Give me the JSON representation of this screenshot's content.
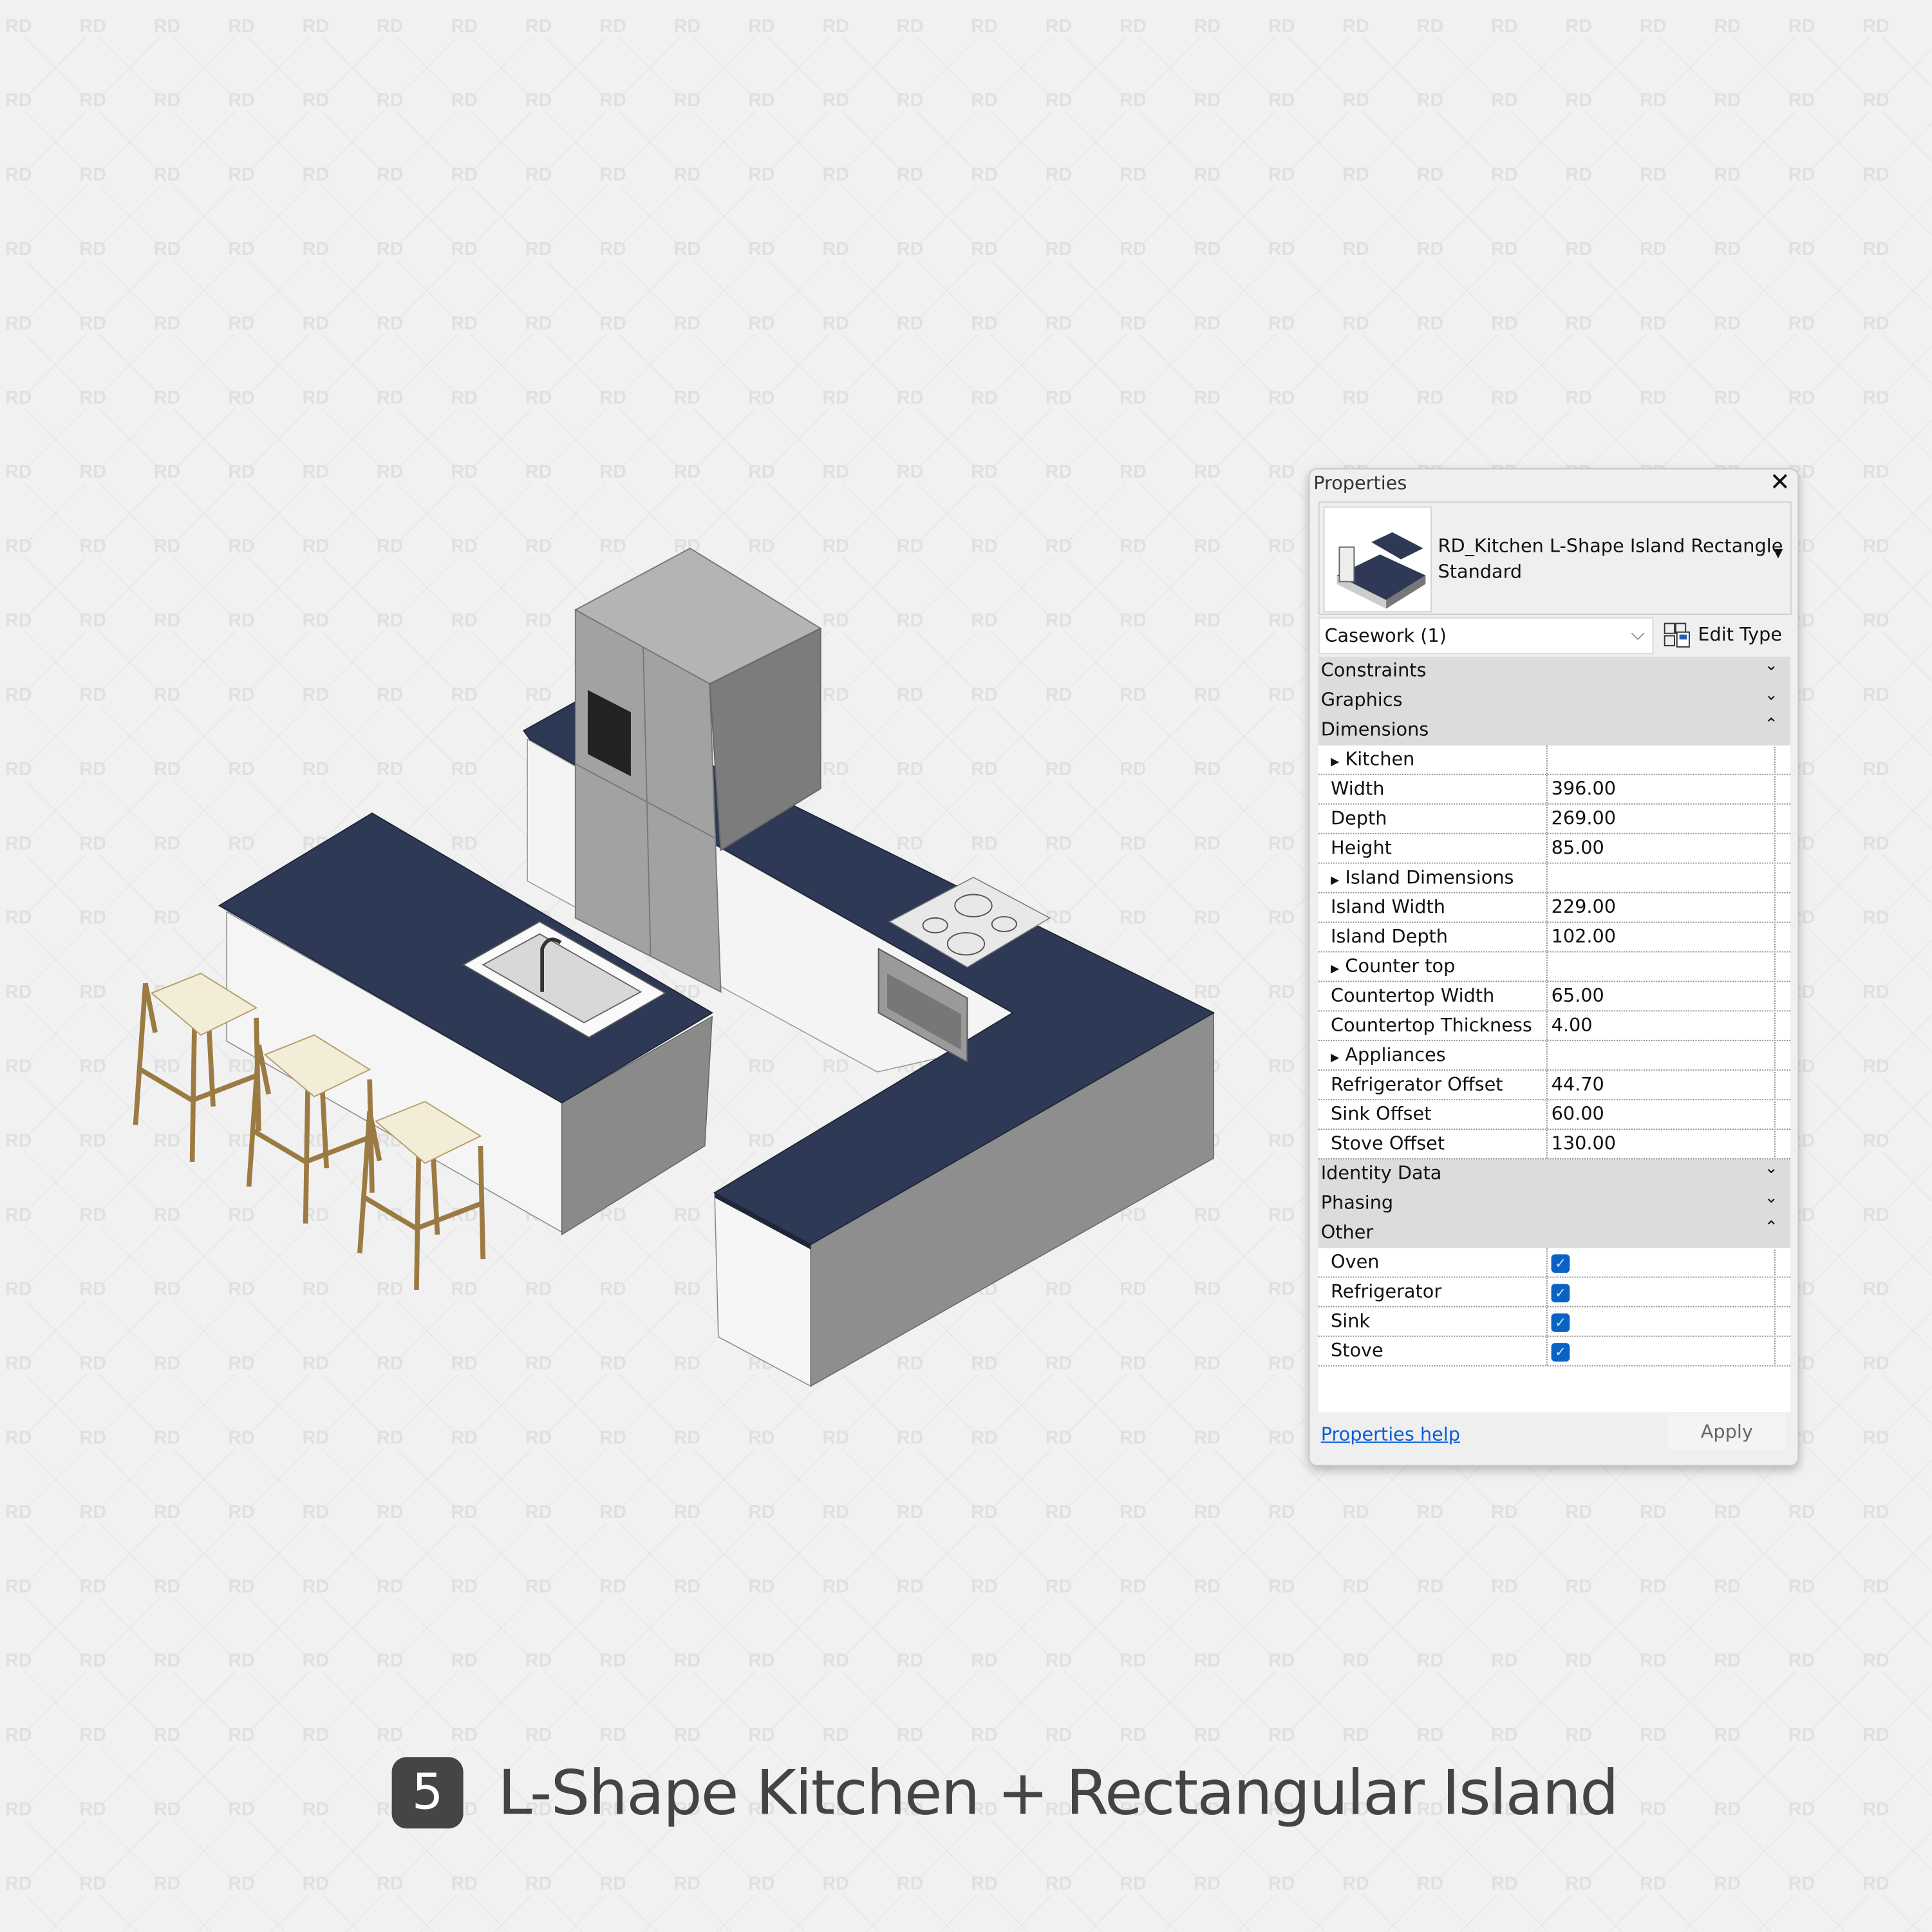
{
  "watermark": "RD",
  "colors": {
    "countertop": "#2e3a55",
    "checkbox": "#0a63c4",
    "link": "#0b5dd7",
    "badge": "#454545"
  },
  "properties": {
    "title": "Properties",
    "close_icon": "close-icon",
    "type_name_line1": "RD_Kitchen L-Shape Island Rectangle",
    "type_name_line2": "Standard",
    "selector": "Casework (1)",
    "edit_type": "Edit Type",
    "categories": {
      "constraints": "Constraints",
      "graphics": "Graphics",
      "dimensions": "Dimensions",
      "identity": "Identity Data",
      "phasing": "Phasing",
      "other": "Other"
    },
    "dimension_rows": [
      {
        "label": "Kitchen",
        "value": ""
      },
      {
        "label": "Width",
        "value": "396.00"
      },
      {
        "label": "Depth",
        "value": "269.00"
      },
      {
        "label": "Height",
        "value": "85.00"
      },
      {
        "label": "Island Dimensions",
        "value": ""
      },
      {
        "label": "Island Width",
        "value": "229.00"
      },
      {
        "label": "Island Depth",
        "value": "102.00"
      },
      {
        "label": "Counter top",
        "value": ""
      },
      {
        "label": "Countertop Width",
        "value": "65.00"
      },
      {
        "label": "Countertop Thickness",
        "value": "4.00"
      },
      {
        "label": "Appliances",
        "value": ""
      },
      {
        "label": "Refrigerator Offset",
        "value": "44.70"
      },
      {
        "label": "Sink Offset",
        "value": "60.00"
      },
      {
        "label": "Stove Offset",
        "value": "130.00"
      }
    ],
    "other_rows": [
      {
        "label": "Oven",
        "checked": true
      },
      {
        "label": "Refrigerator",
        "checked": true
      },
      {
        "label": "Sink",
        "checked": true
      },
      {
        "label": "Stove",
        "checked": true
      }
    ],
    "help_link": "Properties help",
    "apply": "Apply"
  },
  "caption": {
    "number": "5",
    "text": "L-Shape Kitchen + Rectangular Island"
  }
}
